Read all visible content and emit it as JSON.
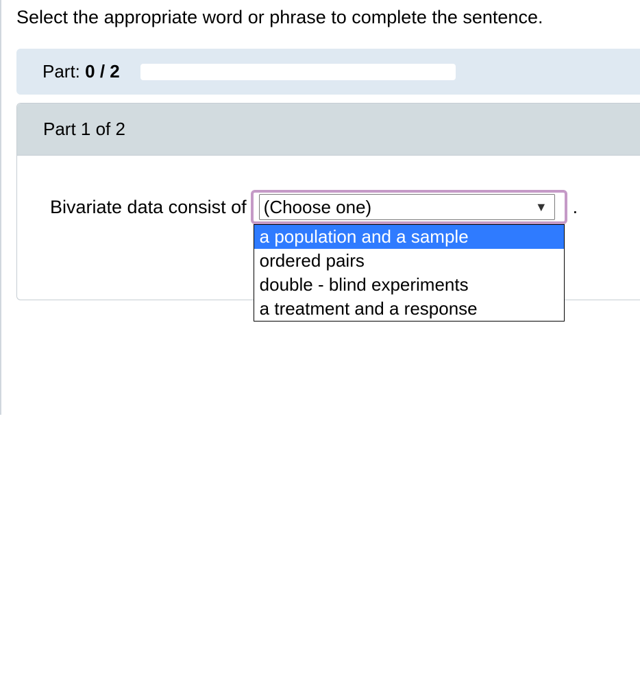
{
  "instruction": "Select the appropriate word or phrase to complete the sentence.",
  "progress": {
    "label_prefix": "Part: ",
    "completed": "0",
    "separator": " / ",
    "total": "2"
  },
  "part": {
    "header": "Part 1 of 2",
    "sentence_prefix": "Bivariate data consist of",
    "trailing": "."
  },
  "dropdown": {
    "placeholder": "(Choose one)",
    "options": [
      "a population and a sample",
      "ordered pairs",
      "double - blind experiments",
      "a treatment and a response"
    ],
    "highlighted_index": 0
  }
}
